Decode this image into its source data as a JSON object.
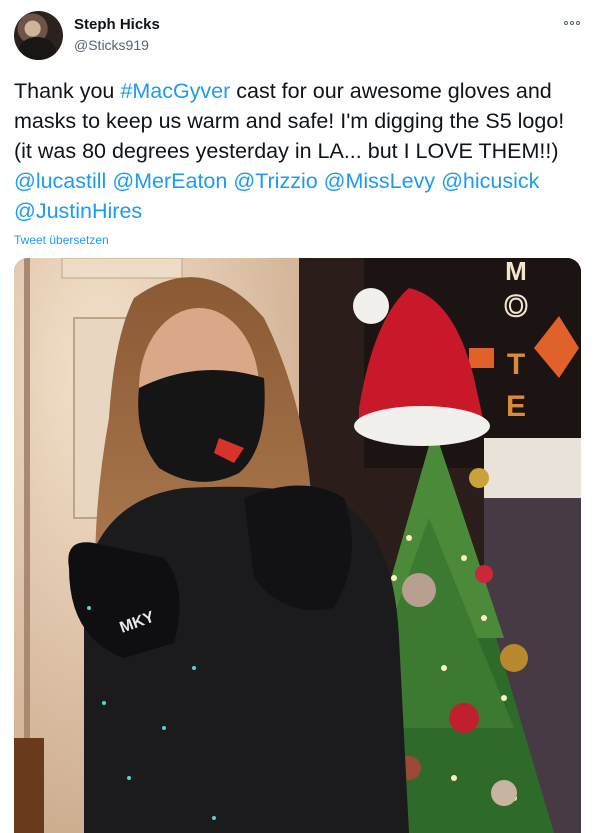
{
  "tweet": {
    "author_name": "Steph Hicks",
    "author_handle": "@Sticks919",
    "more_icon": "more-horizontal-icon",
    "text_segments": [
      {
        "text": "Thank you ",
        "link": false
      },
      {
        "text": "#MacGyver",
        "link": true
      },
      {
        "text": " cast for our awesome gloves and masks to keep us warm and safe! I'm digging the S5 logo! (it was 80 degrees yesterday in LA... but I LOVE THEM!!) ",
        "link": false
      },
      {
        "text": "@lucastill",
        "link": true
      },
      {
        "text": " ",
        "link": false
      },
      {
        "text": "@MerEaton",
        "link": true
      },
      {
        "text": " ",
        "link": false
      },
      {
        "text": "@Trizzio",
        "link": true
      },
      {
        "text": " ",
        "link": false
      },
      {
        "text": "@MissLevy",
        "link": true
      },
      {
        "text": " ",
        "link": false
      },
      {
        "text": "@hicusick",
        "link": true
      },
      {
        "text": " ",
        "link": false
      },
      {
        "text": "@JustinHires",
        "link": true
      }
    ],
    "translate_label": "Tweet übersetzen",
    "photo": {
      "sign_letters": [
        "M",
        "O",
        "T",
        "E"
      ],
      "glove_logo_text": "MKY"
    }
  },
  "colors": {
    "link": "#1d9bf0",
    "text": "#0f1419",
    "secondary": "#536471",
    "background": "#ffffff"
  }
}
